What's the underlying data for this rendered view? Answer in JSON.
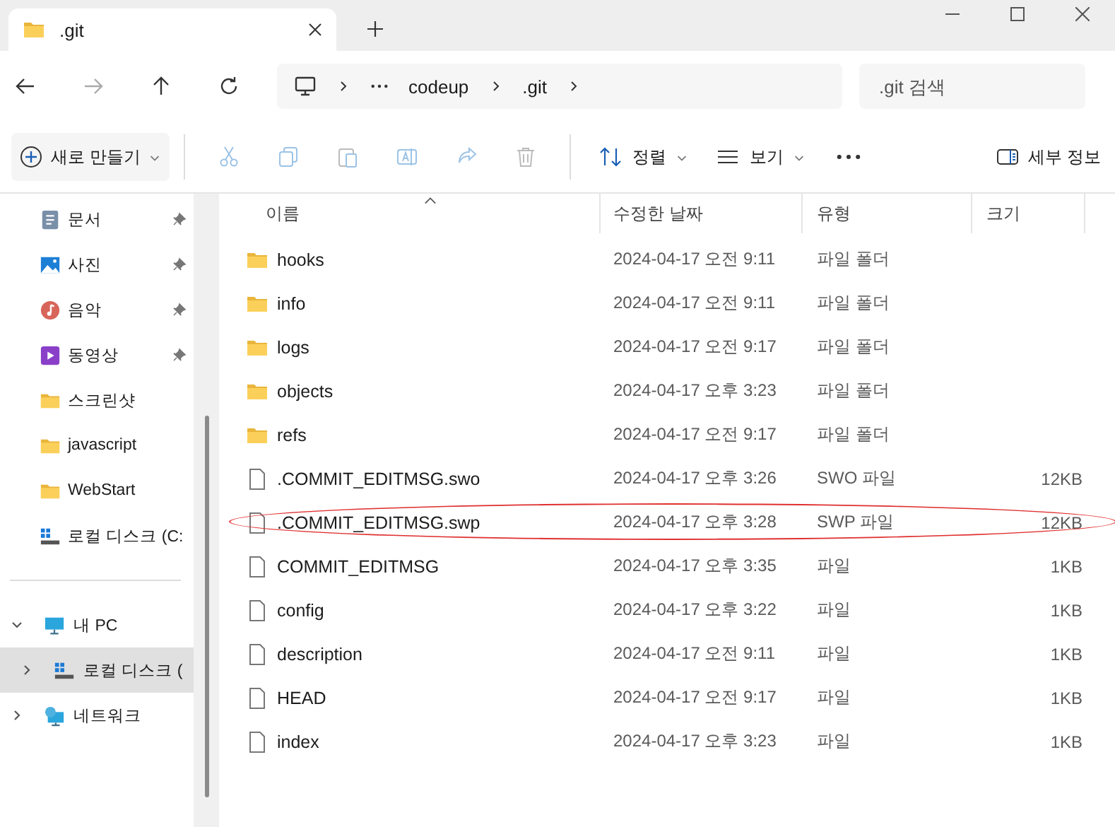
{
  "window": {
    "tab_title": ".git"
  },
  "nav": {
    "breadcrumb": [
      "codeup",
      ".git"
    ],
    "search": {
      "placeholder": ".git 검색"
    }
  },
  "toolbar": {
    "new_button": "새로 만들기",
    "sort_button": "정렬",
    "view_button": "보기",
    "details_button": "세부 정보"
  },
  "sidebar": {
    "quick_access": [
      {
        "label": "문서",
        "kind": "documents",
        "pinned": true
      },
      {
        "label": "사진",
        "kind": "pictures",
        "pinned": true
      },
      {
        "label": "음악",
        "kind": "music",
        "pinned": true
      },
      {
        "label": "동영상",
        "kind": "videos",
        "pinned": true
      },
      {
        "label": "스크린샷",
        "kind": "folder",
        "pinned": false
      },
      {
        "label": "javascript",
        "kind": "folder",
        "pinned": false
      },
      {
        "label": "WebStart",
        "kind": "folder",
        "pinned": false
      },
      {
        "label": "로컬 디스크 (C:",
        "kind": "drive",
        "pinned": false
      }
    ],
    "tree": [
      {
        "label": "내 PC",
        "kind": "pc",
        "expanded": true,
        "selected": false,
        "children": [
          {
            "label": "로컬 디스크 (",
            "kind": "drive",
            "expanded": false,
            "selected": true
          }
        ]
      },
      {
        "label": "네트워크",
        "kind": "network",
        "expanded": false,
        "selected": false
      }
    ]
  },
  "table": {
    "columns": [
      "이름",
      "수정한 날짜",
      "유형",
      "크기"
    ],
    "rows": [
      {
        "name": "hooks",
        "kind": "folder",
        "date": "2024-04-17 오전 9:11",
        "type": "파일 폴더",
        "circled": false
      },
      {
        "name": "info",
        "kind": "folder",
        "date": "2024-04-17 오전 9:11",
        "type": "파일 폴더",
        "circled": false
      },
      {
        "name": "logs",
        "kind": "folder",
        "date": "2024-04-17 오전 9:17",
        "type": "파일 폴더",
        "circled": false
      },
      {
        "name": "objects",
        "kind": "folder",
        "date": "2024-04-17 오후 3:23",
        "type": "파일 폴더",
        "circled": false
      },
      {
        "name": "refs",
        "kind": "folder",
        "date": "2024-04-17 오전 9:17",
        "type": "파일 폴더",
        "circled": false
      },
      {
        "name": ".COMMIT_EDITMSG.swo",
        "kind": "file",
        "date": "2024-04-17 오후 3:26",
        "type": "SWO 파일",
        "size": "12KB",
        "circled": false
      },
      {
        "name": ".COMMIT_EDITMSG.swp",
        "kind": "file",
        "date": "2024-04-17 오후 3:28",
        "type": "SWP 파일",
        "size": "12KB",
        "circled": true
      },
      {
        "name": "COMMIT_EDITMSG",
        "kind": "file",
        "date": "2024-04-17 오후 3:35",
        "type": "파일",
        "size": "1KB",
        "circled": false
      },
      {
        "name": "config",
        "kind": "file",
        "date": "2024-04-17 오후 3:22",
        "type": "파일",
        "size": "1KB",
        "circled": false
      },
      {
        "name": "description",
        "kind": "file",
        "date": "2024-04-17 오전 9:11",
        "type": "파일",
        "size": "1KB",
        "circled": false
      },
      {
        "name": "HEAD",
        "kind": "file",
        "date": "2024-04-17 오전 9:17",
        "type": "파일",
        "size": "1KB",
        "circled": false
      },
      {
        "name": "index",
        "kind": "file",
        "date": "2024-04-17 오후 3:23",
        "type": "파일",
        "size": "1KB",
        "circled": false
      }
    ]
  }
}
